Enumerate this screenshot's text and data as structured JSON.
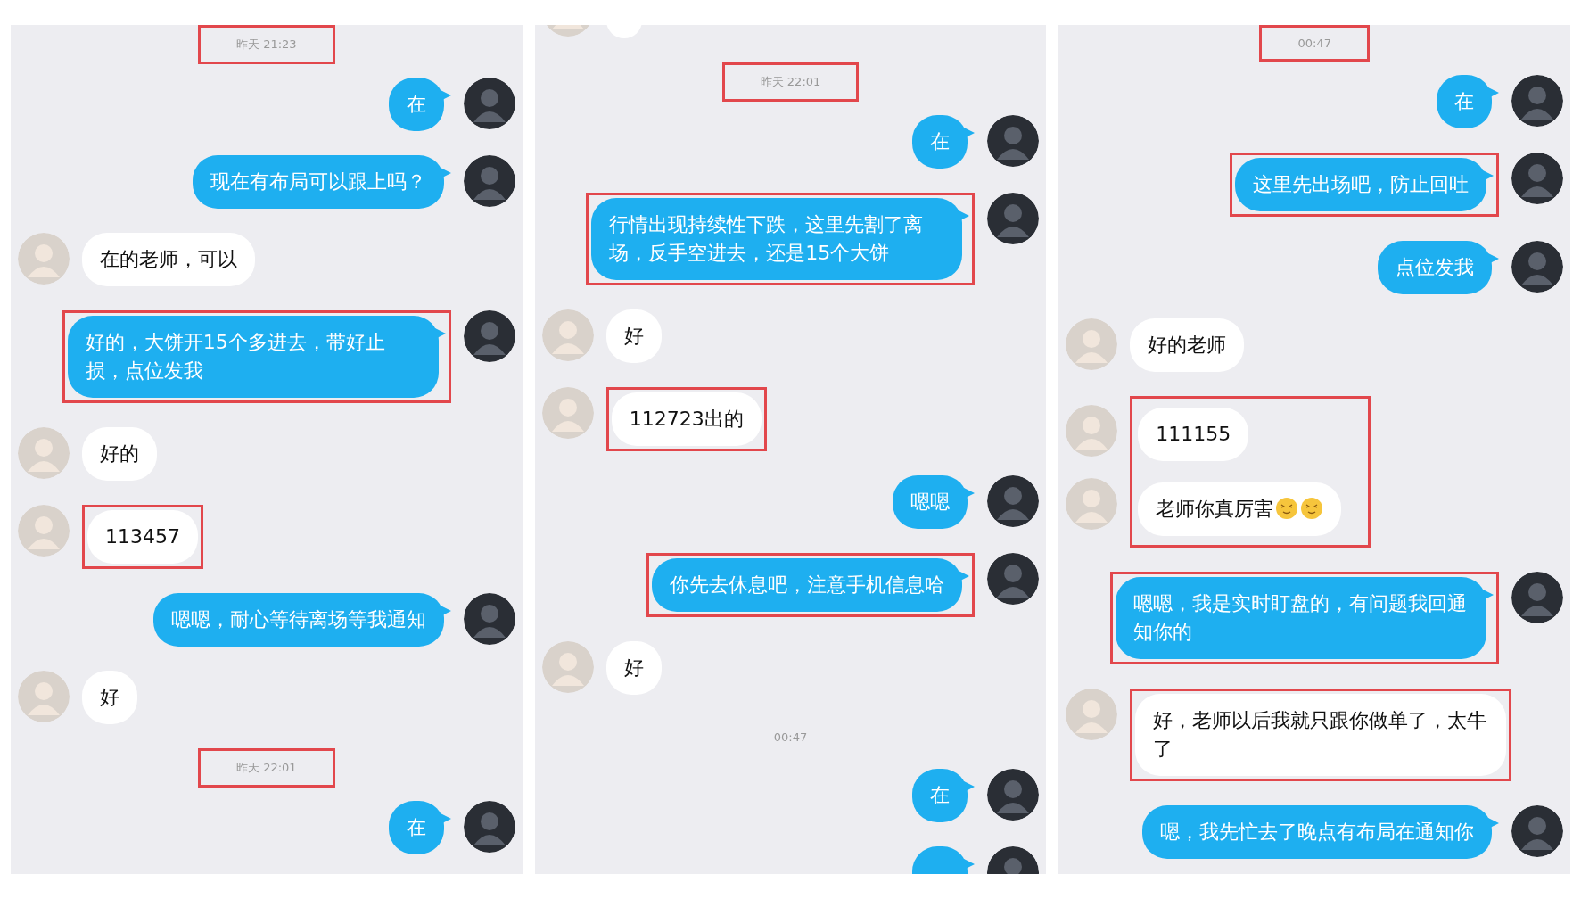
{
  "panels": [
    {
      "items": [
        {
          "kind": "time",
          "text": "昨天 21:23",
          "highlighted": true
        },
        {
          "kind": "sent",
          "text": "在",
          "highlighted": false
        },
        {
          "kind": "sent",
          "text": "现在有布局可以跟上吗？",
          "highlighted": false
        },
        {
          "kind": "received",
          "text": "在的老师，可以",
          "highlighted": false
        },
        {
          "kind": "sent",
          "text": "好的，大饼开15个多进去，带好止损，点位发我",
          "highlighted": true
        },
        {
          "kind": "received",
          "text": "好的",
          "highlighted": false
        },
        {
          "kind": "received",
          "text": "113457",
          "highlighted": true
        },
        {
          "kind": "sent",
          "text": "嗯嗯，耐心等待离场等我通知",
          "highlighted": false
        },
        {
          "kind": "received",
          "text": "好",
          "highlighted": false
        },
        {
          "kind": "time",
          "text": "昨天 22:01",
          "highlighted": true
        },
        {
          "kind": "sent",
          "text": "在",
          "highlighted": false
        }
      ]
    },
    {
      "items": [
        {
          "kind": "received",
          "highlighted": false
        },
        {
          "kind": "time",
          "text": "昨天 22:01",
          "highlighted": true
        },
        {
          "kind": "sent",
          "text": "在",
          "highlighted": false
        },
        {
          "kind": "sent",
          "text": "行情出现持续性下跌，这里先割了离场，反手空进去，还是15个大饼",
          "highlighted": true
        },
        {
          "kind": "received",
          "text": "好",
          "highlighted": false
        },
        {
          "kind": "received",
          "text": "112723出的",
          "highlighted": true
        },
        {
          "kind": "sent",
          "text": "嗯嗯",
          "highlighted": false
        },
        {
          "kind": "sent",
          "text": "你先去休息吧，注意手机信息哈",
          "highlighted": true
        },
        {
          "kind": "received",
          "text": "好",
          "highlighted": false
        },
        {
          "kind": "time",
          "text": "00:47",
          "highlighted": false
        },
        {
          "kind": "sent",
          "text": "在",
          "highlighted": false
        },
        {
          "kind": "sent",
          "highlighted": false
        }
      ]
    },
    {
      "items": [
        {
          "kind": "time",
          "text": "00:47",
          "highlighted": true
        },
        {
          "kind": "sent",
          "text": "在",
          "highlighted": false
        },
        {
          "kind": "sent",
          "text": "这里先出场吧，防止回吐",
          "highlighted": true
        },
        {
          "kind": "sent",
          "text": "点位发我",
          "highlighted": false
        },
        {
          "kind": "received",
          "text": "好的老师",
          "highlighted": false
        },
        {
          "kind": "group",
          "highlighted": true,
          "children": [
            {
              "kind": "received",
              "text": "111155",
              "highlighted": false
            },
            {
              "kind": "received",
              "text": "老师你真厉害",
              "highlighted": false,
              "icons": [
                {
                  "kind": "emoji"
                },
                {
                  "kind": "emoji"
                }
              ]
            }
          ]
        },
        {
          "kind": "sent",
          "text": "嗯嗯，我是实时盯盘的，有问题我回通知你的",
          "highlighted": true
        },
        {
          "kind": "received",
          "text": "好，老师以后我就只跟你做单了，太牛了",
          "highlighted": true
        },
        {
          "kind": "sent",
          "text": "嗯，我先忙去了晚点有布局在通知你",
          "highlighted": false
        }
      ]
    }
  ]
}
